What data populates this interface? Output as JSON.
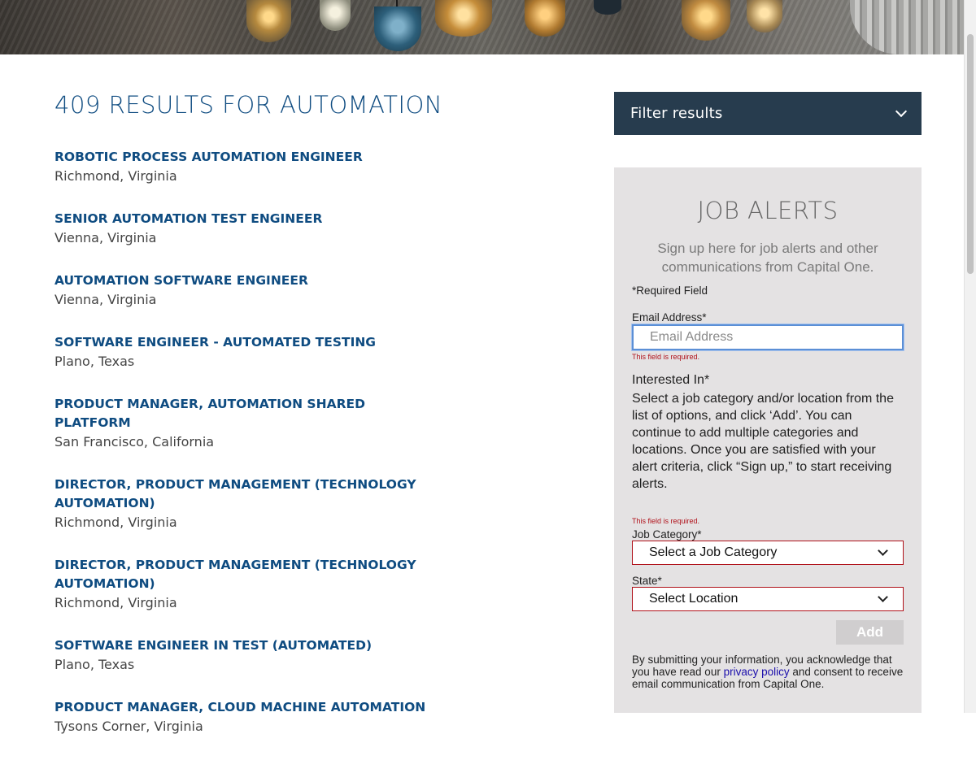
{
  "results": {
    "heading": "409 RESULTS FOR AUTOMATION",
    "jobs": [
      {
        "title": "ROBOTIC PROCESS AUTOMATION ENGINEER",
        "location": "Richmond, Virginia"
      },
      {
        "title": "SENIOR AUTOMATION TEST ENGINEER",
        "location": "Vienna, Virginia"
      },
      {
        "title": "AUTOMATION SOFTWARE ENGINEER",
        "location": "Vienna, Virginia"
      },
      {
        "title": "SOFTWARE ENGINEER - AUTOMATED TESTING",
        "location": "Plano, Texas"
      },
      {
        "title": "PRODUCT MANAGER, AUTOMATION SHARED PLATFORM",
        "location": "San Francisco, California"
      },
      {
        "title": "DIRECTOR, PRODUCT MANAGEMENT (TECHNOLOGY AUTOMATION)",
        "location": "Richmond, Virginia"
      },
      {
        "title": "DIRECTOR, PRODUCT MANAGEMENT (TECHNOLOGY AUTOMATION)",
        "location": "Richmond, Virginia"
      },
      {
        "title": "SOFTWARE ENGINEER IN TEST (AUTOMATED)",
        "location": "Plano, Texas"
      },
      {
        "title": "PRODUCT MANAGER, CLOUD MACHINE AUTOMATION",
        "location": "Tysons Corner, Virginia"
      }
    ]
  },
  "filter": {
    "label": "Filter results",
    "icon": "chevron-down-icon"
  },
  "alerts": {
    "title": "JOB ALERTS",
    "subtitle": "Sign up here for job alerts and other communications from Capital One.",
    "required_note": "*Required Field",
    "email_label": "Email Address*",
    "email_placeholder": "Email Address",
    "email_value": "",
    "email_error": "This field is required.",
    "interested_label": "Interested In*",
    "interested_text": "Select a job category and/or location from the list of options, and click ‘Add’. You can continue to add multiple categories and locations. Once you are satisfied with your alert criteria, click “Sign up,” to start receiving alerts.",
    "category_error": "This field is required.",
    "category_label": "Job Category*",
    "category_selected": "Select a Job Category",
    "state_label": "State*",
    "state_selected": "Select Location",
    "add_label": "Add",
    "consent_before": "By submitting your information, you acknowledge that you have read our ",
    "consent_link": "privacy policy",
    "consent_after": " and consent to receive email communication from Capital One."
  },
  "colors": {
    "heading_blue": "#0f4c81",
    "filter_bg": "#273c4e",
    "alerts_bg": "#e4e2e3",
    "error_red": "#b0111a"
  }
}
